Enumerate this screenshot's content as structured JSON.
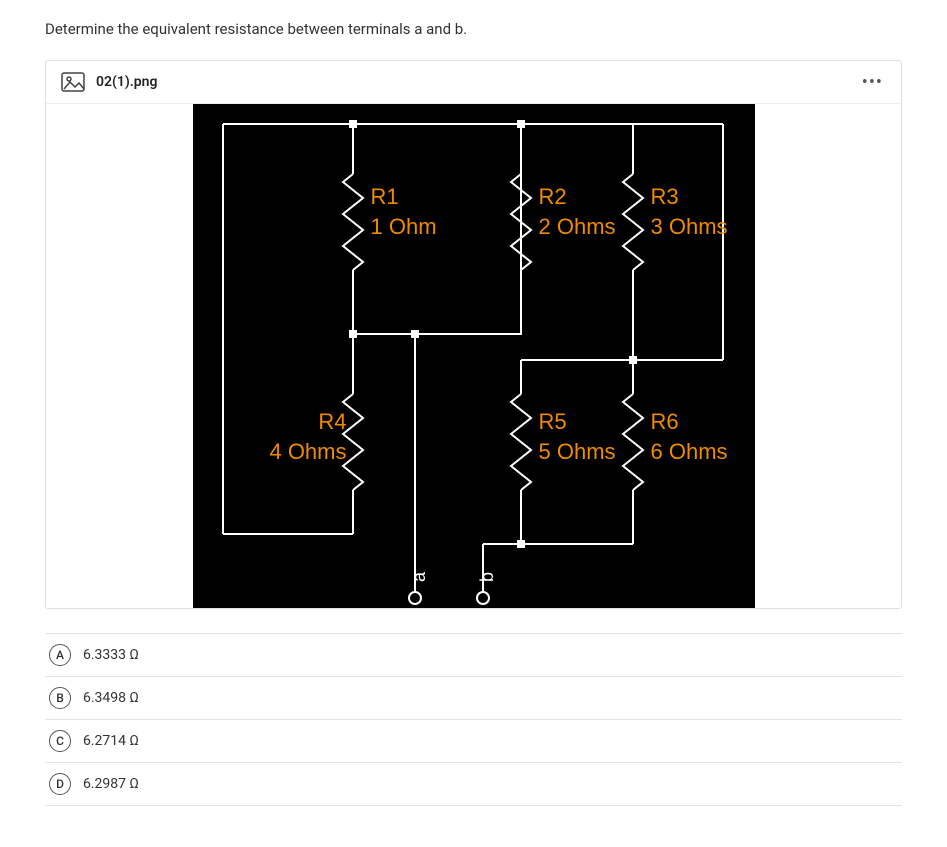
{
  "question": "Determine the equivalent resistance between terminals a and b.",
  "attachment": {
    "filename": "02(1).png"
  },
  "circuit": {
    "R1": {
      "name": "R1",
      "val": "1 Ohm"
    },
    "R2": {
      "name": "R2",
      "val": "2 Ohms"
    },
    "R3": {
      "name": "R3",
      "val": "3 Ohms"
    },
    "R4": {
      "name": "R4",
      "val": "4 Ohms"
    },
    "R5": {
      "name": "R5",
      "val": "5 Ohms"
    },
    "R6": {
      "name": "R6",
      "val": "6 Ohms"
    },
    "termA": "a",
    "termB": "b"
  },
  "answers": {
    "A": "6.3333 Ω",
    "B": "6.3498 Ω",
    "C": "6.2714 Ω",
    "D": "6.2987 Ω"
  }
}
